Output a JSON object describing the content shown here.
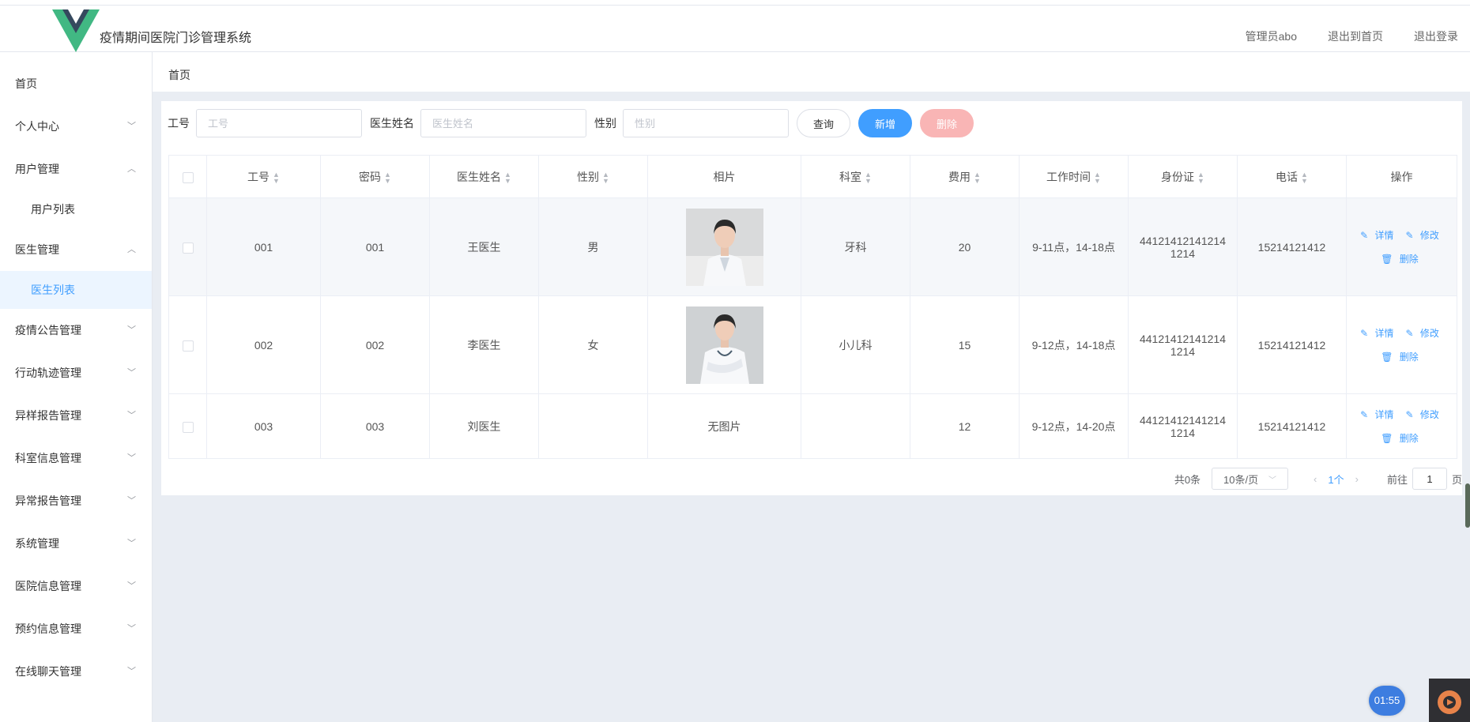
{
  "header": {
    "app_title": "疫情期间医院门诊管理系统",
    "admin_label": "管理员abo",
    "back_home": "退出到首页",
    "logout": "退出登录",
    "logo_colors": [
      "#41b883",
      "#35495e"
    ]
  },
  "sidebar": {
    "items": [
      {
        "label": "首页"
      },
      {
        "label": "个人中心"
      },
      {
        "label": "用户管理"
      },
      {
        "label": "用户列表"
      },
      {
        "label": "医生管理"
      },
      {
        "label": "医生列表"
      },
      {
        "label": "疫情公告管理"
      },
      {
        "label": "行动轨迹管理"
      },
      {
        "label": "异样报告管理"
      },
      {
        "label": "科室信息管理"
      },
      {
        "label": "异常报告管理"
      },
      {
        "label": "系统管理"
      },
      {
        "label": "医院信息管理"
      },
      {
        "label": "预约信息管理"
      },
      {
        "label": "在线聊天管理"
      }
    ]
  },
  "breadcrumb": "首页",
  "search": {
    "job_no_label": "工号",
    "job_no_placeholder": "工号",
    "name_label": "医生姓名",
    "name_placeholder": "医生姓名",
    "gender_label": "性别",
    "gender_placeholder": "性别",
    "query_btn": "查询",
    "add_btn": "新增",
    "delete_btn": "删除"
  },
  "table": {
    "headers": {
      "job_no": "工号",
      "password": "密码",
      "name": "医生姓名",
      "gender": "性别",
      "photo": "相片",
      "dept": "科室",
      "fee": "费用",
      "work_time": "工作时间",
      "id_card": "身份证",
      "phone": "电话",
      "ops": "操作"
    },
    "rows": [
      {
        "job_no": "001",
        "password": "001",
        "name": "王医生",
        "gender": "男",
        "photo": "",
        "dept": "牙科",
        "fee": "20",
        "work_time": "9-11点，14-18点",
        "id_card_1": "44121412141214",
        "id_card_2": "1214",
        "phone": "15214121412"
      },
      {
        "job_no": "002",
        "password": "002",
        "name": "李医生",
        "gender": "女",
        "photo": "",
        "dept": "小儿科",
        "fee": "15",
        "work_time": "9-12点，14-18点",
        "id_card_1": "44121412141214",
        "id_card_2": "1214",
        "phone": "15214121412"
      },
      {
        "job_no": "003",
        "password": "003",
        "name": "刘医生",
        "gender": "",
        "photo": "无图片",
        "dept": "",
        "fee": "12",
        "work_time": "9-12点，14-20点",
        "id_card_1": "44121412141214",
        "id_card_2": "1214",
        "phone": "15214121412"
      }
    ],
    "op_detail": "详情",
    "op_edit": "修改",
    "op_delete": "删除"
  },
  "pagination": {
    "total": "共0条",
    "page_size": "10条/页",
    "current": "1个",
    "goto_label": "前往",
    "goto_value": "1",
    "page_suffix": "页"
  },
  "timer": "01:55"
}
